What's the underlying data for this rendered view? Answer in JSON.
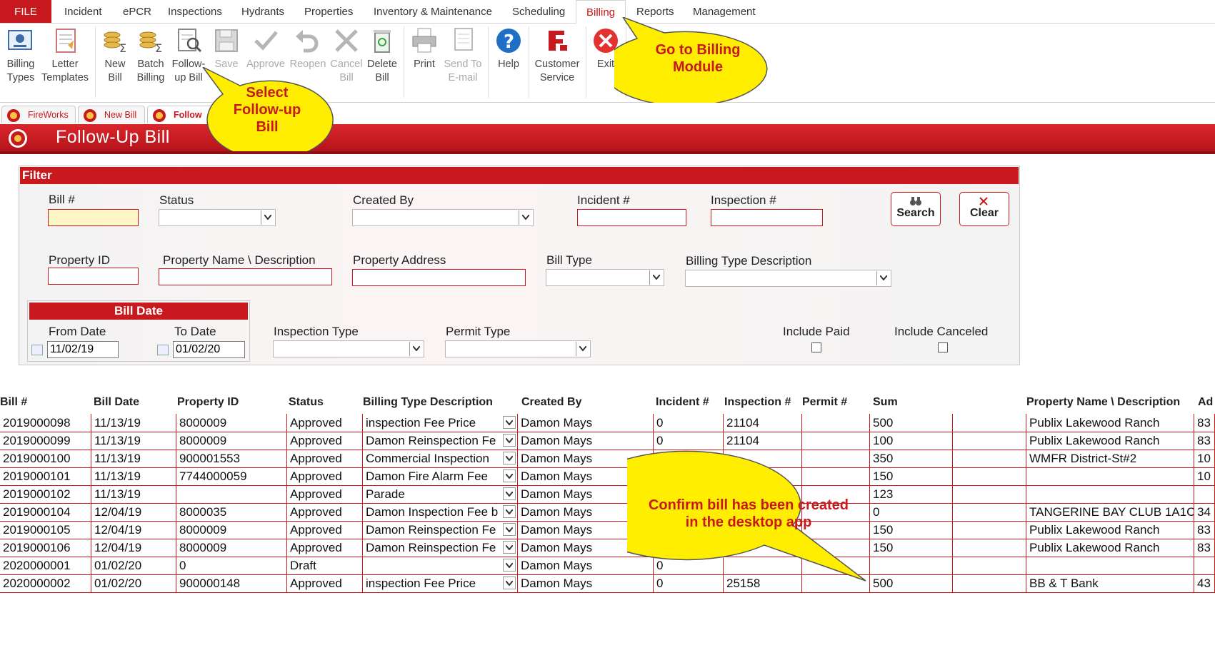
{
  "menu": {
    "file": "FILE",
    "items": [
      "Incident",
      "ePCR",
      "Inspections",
      "Hydrants",
      "Properties",
      "Inventory & Maintenance",
      "Scheduling",
      "Billing",
      "Reports",
      "Management"
    ]
  },
  "ribbon": {
    "billing_types": [
      "Billing",
      "Types"
    ],
    "letter_templates": [
      "Letter",
      "Templates"
    ],
    "new_bill": [
      "New",
      "Bill"
    ],
    "batch_billing": [
      "Batch",
      "Billing"
    ],
    "followup_bill": [
      "Follow-",
      "up Bill"
    ],
    "save": [
      "Save",
      ""
    ],
    "approve": [
      "Approve",
      ""
    ],
    "reopen": [
      "Reopen",
      ""
    ],
    "cancel_bill": [
      "Cancel",
      "Bill"
    ],
    "delete_bill": [
      "Delete",
      "Bill"
    ],
    "print": [
      "Print",
      ""
    ],
    "send_email": [
      "Send To",
      "E-mail"
    ],
    "help": [
      "Help",
      ""
    ],
    "customer_service": [
      "Customer",
      "Service"
    ],
    "exit": [
      "Exit",
      ""
    ]
  },
  "tabs": [
    "FireWorks",
    "New Bill",
    "Follow"
  ],
  "title": "Follow-Up Bill",
  "filter": {
    "header": "Filter",
    "bill_no": "Bill #",
    "status": "Status",
    "created_by": "Created By",
    "incident_no": "Incident #",
    "inspection_no": "Inspection #",
    "property_id": "Property ID",
    "property_name": "Property Name \\ Description",
    "property_address": "Property Address",
    "bill_type": "Bill Type",
    "billing_type_desc": "Billing Type Description",
    "bill_date_header": "Bill Date",
    "from_date": "From Date",
    "to_date": "To Date",
    "from_date_value": "11/02/19",
    "to_date_value": "01/02/20",
    "inspection_type": "Inspection Type",
    "permit_type": "Permit Type",
    "include_paid": "Include Paid",
    "include_canceled": "Include Canceled",
    "search": "Search",
    "clear": "Clear"
  },
  "grid": {
    "headers": [
      "Bill #",
      "Bill Date",
      "Property ID",
      "Status",
      "Billing Type Description",
      "Created By",
      "Incident #",
      "Inspection #",
      "Permit #",
      "Sum",
      "Property Name \\ Description",
      "Ad"
    ],
    "rows": [
      [
        "2019000098",
        "11/13/19",
        "8000009",
        "Approved",
        "inspection Fee Price",
        "Damon Mays",
        "0",
        "21104",
        "",
        "500",
        "Publix Lakewood Ranch",
        "83"
      ],
      [
        "2019000099",
        "11/13/19",
        "8000009",
        "Approved",
        "Damon Reinspection Fe",
        "Damon Mays",
        "0",
        "21104",
        "",
        "100",
        "Publix Lakewood Ranch",
        "83"
      ],
      [
        "2019000100",
        "11/13/19",
        "900001553",
        "Approved",
        "Commercial Inspection",
        "Damon Mays",
        "",
        "",
        "",
        "350",
        "WMFR District-St#2",
        "10"
      ],
      [
        "2019000101",
        "11/13/19",
        "7744000059",
        "Approved",
        "Damon Fire Alarm Fee",
        "Damon Mays",
        "",
        "",
        "",
        "150",
        "",
        "10"
      ],
      [
        "2019000102",
        "11/13/19",
        "",
        "Approved",
        "Parade",
        "Damon Mays",
        "",
        "",
        "",
        "123",
        "",
        ""
      ],
      [
        "2019000104",
        "12/04/19",
        "8000035",
        "Approved",
        "Damon Inspection Fee b",
        "Damon Mays",
        "",
        "",
        "",
        "0",
        "TANGERINE BAY CLUB 1A1C",
        "34"
      ],
      [
        "2019000105",
        "12/04/19",
        "8000009",
        "Approved",
        "Damon Reinspection Fe",
        "Damon Mays",
        "",
        "",
        "",
        "150",
        "Publix Lakewood Ranch",
        "83"
      ],
      [
        "2019000106",
        "12/04/19",
        "8000009",
        "Approved",
        "Damon Reinspection Fe",
        "Damon Mays",
        "",
        "",
        "",
        "150",
        "Publix Lakewood Ranch",
        "83"
      ],
      [
        "2020000001",
        "01/02/20",
        "0",
        "Draft",
        "",
        "Damon Mays",
        "0",
        "",
        "",
        "",
        "",
        ""
      ],
      [
        "2020000002",
        "01/02/20",
        "900000148",
        "Approved",
        "inspection Fee Price",
        "Damon Mays",
        "0",
        "25158",
        "",
        "500",
        "BB & T Bank",
        "43"
      ]
    ]
  },
  "callouts": {
    "billing": [
      "Go to Billing",
      "Module"
    ],
    "followup": [
      "Select",
      "Follow-up",
      "Bill"
    ],
    "confirm": [
      "Confirm bill has been created",
      "in the desktop app"
    ]
  },
  "colors": {
    "accent": "#c8191e",
    "callout": "#ffee00"
  }
}
